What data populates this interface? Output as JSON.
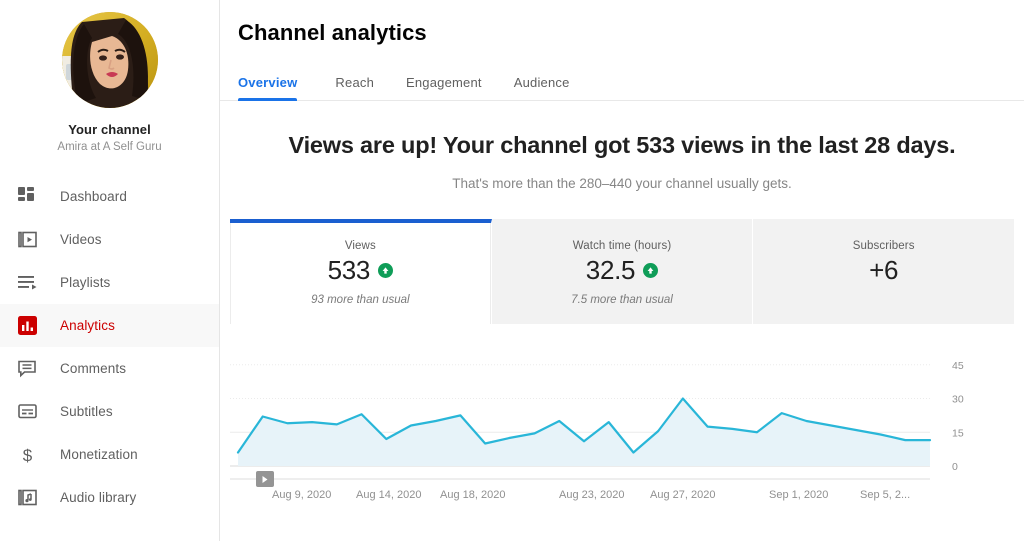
{
  "sidebar": {
    "channel": {
      "avatar_icon": "user-avatar-photo",
      "name": "Your channel",
      "handle": "Amira at A Self Guru"
    },
    "items": [
      {
        "label": "Dashboard",
        "icon": "dashboard-icon",
        "active": false
      },
      {
        "label": "Videos",
        "icon": "videos-icon",
        "active": false
      },
      {
        "label": "Playlists",
        "icon": "playlists-icon",
        "active": false
      },
      {
        "label": "Analytics",
        "icon": "analytics-icon",
        "active": true
      },
      {
        "label": "Comments",
        "icon": "comments-icon",
        "active": false
      },
      {
        "label": "Subtitles",
        "icon": "subtitles-icon",
        "active": false
      },
      {
        "label": "Monetization",
        "icon": "monetization-icon",
        "active": false
      },
      {
        "label": "Audio library",
        "icon": "audio-library-icon",
        "active": false
      }
    ]
  },
  "header": {
    "title": "Channel analytics",
    "tabs": [
      {
        "label": "Overview",
        "active": true
      },
      {
        "label": "Reach",
        "active": false
      },
      {
        "label": "Engagement",
        "active": false
      },
      {
        "label": "Audience",
        "active": false
      }
    ]
  },
  "summary": {
    "headline": "Views are up! Your channel got 533 views in the last 28 days.",
    "subheadline": "That's more than the 280–440 your channel usually gets."
  },
  "metric_cards": [
    {
      "label": "Views",
      "value": "533",
      "trend_icon": "arrow-up-icon",
      "has_trend": true,
      "sub": "93 more than usual",
      "selected": true
    },
    {
      "label": "Watch time (hours)",
      "value": "32.5",
      "trend_icon": "arrow-up-icon",
      "has_trend": true,
      "sub": "7.5 more than usual",
      "selected": false
    },
    {
      "label": "Subscribers",
      "value": "+6",
      "trend_icon": "",
      "has_trend": false,
      "sub": "",
      "selected": false
    }
  ],
  "colors": {
    "accent_blue": "#1a73e8",
    "card_selected_border": "#1a5fd0",
    "brand_red": "#cc0000",
    "trend_green": "#0f9d58",
    "chart_line": "#29b6d8",
    "chart_fill": "#e7f3f9"
  },
  "chart_data": {
    "type": "area",
    "title": "Views",
    "xlabel": "",
    "ylabel": "",
    "ylim": [
      0,
      48
    ],
    "yticks": [
      0,
      15,
      30,
      45
    ],
    "ytick_labels": [
      "0",
      "15",
      "30",
      "45"
    ],
    "grid": true,
    "legend": "none",
    "x_tick_labels": [
      "Aug 9, 2020",
      "Aug 14, 2020",
      "Aug 18, 2020",
      "Aug 23, 2020",
      "Aug 27, 2020",
      "Sep 1, 2020",
      "Sep 5, 2..."
    ],
    "x_tick_positions": [
      0.06,
      0.18,
      0.3,
      0.47,
      0.6,
      0.77,
      0.9
    ],
    "markers": [
      {
        "type": "video-marker-icon",
        "x_fraction": 0.037
      }
    ],
    "series": [
      {
        "name": "Views",
        "values": [
          6,
          22,
          19,
          19.5,
          18.5,
          23,
          12,
          18,
          20,
          22.5,
          10,
          12.5,
          14.5,
          20,
          11,
          19.5,
          6,
          15.5,
          30,
          17.5,
          16.5,
          15,
          23.5,
          20,
          18,
          16,
          14,
          11.5,
          11.5
        ]
      }
    ]
  }
}
